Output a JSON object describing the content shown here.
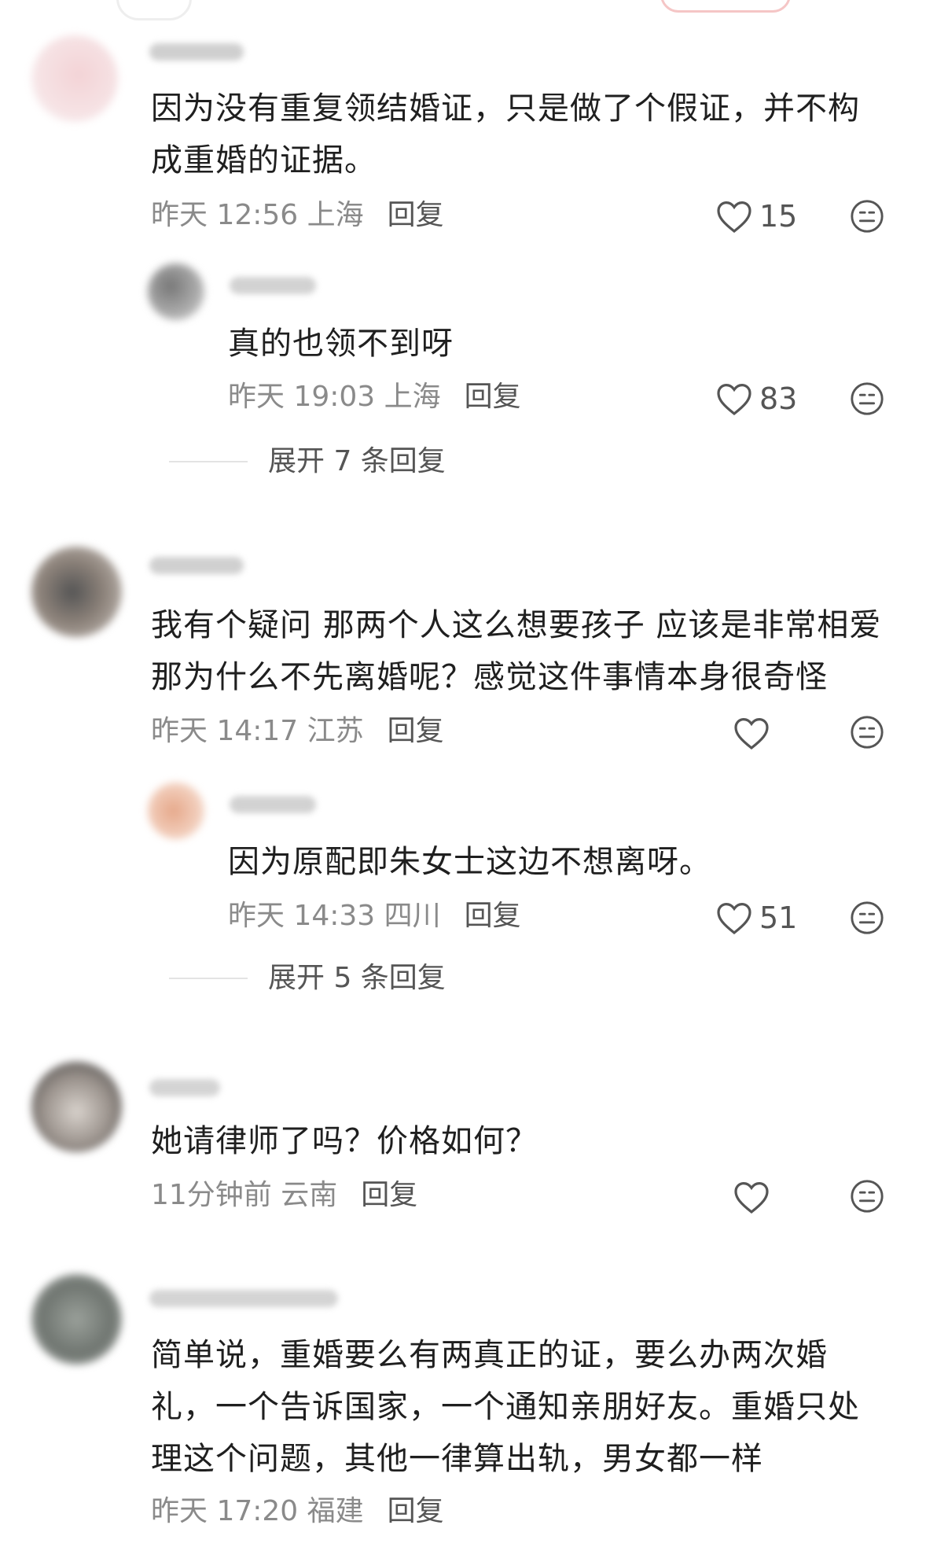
{
  "comments": [
    {
      "text_lines": [
        "因为没有重复领结婚证，只是做了个假证，并不构",
        "成重婚的证据。"
      ],
      "meta": "昨天 12:56 上海",
      "reply_label": "回复",
      "likes": "15",
      "replies": [
        {
          "text_lines": [
            "真的也领不到呀"
          ],
          "meta": "昨天 19:03 上海",
          "reply_label": "回复",
          "likes": "83"
        }
      ],
      "expand_label": "展开 7 条回复"
    },
    {
      "text_lines": [
        "我有个疑问 那两个人这么想要孩子 应该是非常相爱",
        "那为什么不先离婚呢？感觉这件事情本身很奇怪"
      ],
      "meta": "昨天 14:17 江苏",
      "reply_label": "回复",
      "likes": "",
      "replies": [
        {
          "text_lines": [
            "因为原配即朱女士这边不想离呀。"
          ],
          "meta": "昨天 14:33 四川",
          "reply_label": "回复",
          "likes": "51"
        }
      ],
      "expand_label": "展开 5 条回复"
    },
    {
      "text_lines": [
        "她请律师了吗？价格如何？"
      ],
      "meta": "11分钟前 云南",
      "reply_label": "回复",
      "likes": ""
    },
    {
      "text_lines": [
        "简单说，重婚要么有两真正的证，要么办两次婚",
        "礼，一个告诉国家，一个通知亲朋好友。重婚只处",
        "理这个问题，其他一律算出轨，男女都一样"
      ],
      "meta": "昨天 17:20 福建",
      "reply_label": "回复",
      "likes": ""
    }
  ],
  "colors": {
    "text": "#1f1f1f",
    "meta": "#8a8a8a",
    "icon": "#555555",
    "accent": "#f5c6c6"
  },
  "icons": {
    "like": "heart-outline-icon",
    "dislike": "meh-face-icon"
  }
}
